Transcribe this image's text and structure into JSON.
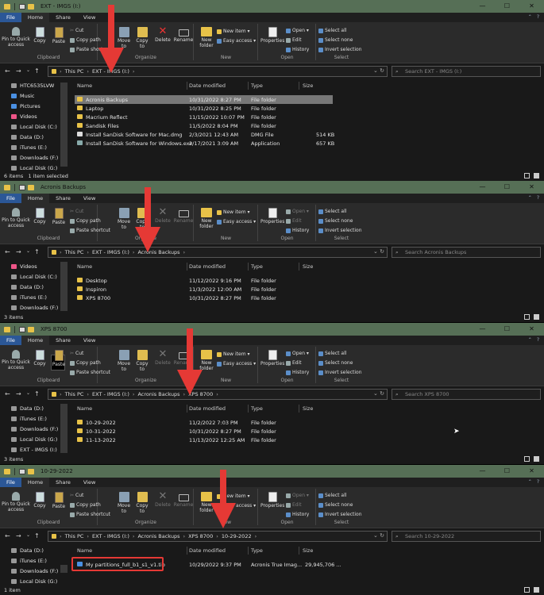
{
  "caption": {
    "min": "—",
    "max": "☐",
    "close": "✕"
  },
  "ribbon": {
    "tabs": [
      "File",
      "Home",
      "Share",
      "View"
    ],
    "pin": "Pin to Quick access",
    "copy": "Copy",
    "paste": "Paste",
    "cut": "Cut",
    "copy_path": "Copy path",
    "paste_shortcut": "Paste shortcut",
    "clipboard": "Clipboard",
    "move_to": "Move to",
    "copy_to": "Copy to",
    "delete": "Delete",
    "rename": "Rename",
    "organize": "Organize",
    "new_folder": "New folder",
    "new_item": "New item ▾",
    "easy_access": "Easy access ▾",
    "new": "New",
    "properties": "Properties",
    "open": "Open ▾",
    "edit": "Edit",
    "history": "History",
    "open_group": "Open",
    "select_all": "Select all",
    "select_none": "Select none",
    "invert_selection": "Invert selection",
    "select": "Select"
  },
  "columns": {
    "name": "Name",
    "date": "Date modified",
    "type": "Type",
    "size": "Size"
  },
  "windows": [
    {
      "title": "EXT - IMGS (I:)",
      "crumbs": [
        "This PC",
        "EXT - IMGS (I:)"
      ],
      "search": "Search EXT - IMGS (I:)",
      "nav": [
        "HTC6535LVW",
        "Music",
        "Pictures",
        "Videos",
        "Local Disk (C:)",
        "Data (D:)",
        "iTunes (E:)",
        "Downloads (F:)",
        "Local Disk (G:)"
      ],
      "files": [
        {
          "name": "Acronis Backups",
          "date": "10/31/2022 8:27 PM",
          "type": "File folder",
          "size": ""
        },
        {
          "name": "Laptop",
          "date": "10/31/2022 8:25 PM",
          "type": "File folder",
          "size": ""
        },
        {
          "name": "Macrium Reflect",
          "date": "11/15/2022 10:07 PM",
          "type": "File folder",
          "size": ""
        },
        {
          "name": "Sandisk Files",
          "date": "11/5/2022 8:04 PM",
          "type": "File folder",
          "size": ""
        },
        {
          "name": "Install SanDisk Software for Mac.dmg",
          "date": "2/3/2021 12:43 AM",
          "type": "DMG File",
          "size": "514 KB"
        },
        {
          "name": "Install SanDisk Software for Windows.exe",
          "date": "2/17/2021 3:09 AM",
          "type": "Application",
          "size": "657 KB"
        }
      ],
      "status": "6 items",
      "status_sel": "1 item selected"
    },
    {
      "title": "Acronis Backups",
      "crumbs": [
        "This PC",
        "EXT - IMGS (I:)",
        "Acronis Backups"
      ],
      "search": "Search Acronis Backups",
      "nav": [
        "Videos",
        "Local Disk (C:)",
        "Data (D:)",
        "iTunes (E:)",
        "Downloads (F:)"
      ],
      "files": [
        {
          "name": "Desktop",
          "date": "11/12/2022 9:16 PM",
          "type": "File folder",
          "size": ""
        },
        {
          "name": "Inspiron",
          "date": "11/3/2022 12:00 AM",
          "type": "File folder",
          "size": ""
        },
        {
          "name": "XPS 8700",
          "date": "10/31/2022 8:27 PM",
          "type": "File folder",
          "size": ""
        }
      ],
      "status": "3 items"
    },
    {
      "title": "XPS 8700",
      "crumbs": [
        "This PC",
        "EXT - IMGS (I:)",
        "Acronis Backups",
        "XPS 8700"
      ],
      "search": "Search XPS 8700",
      "nav": [
        "Data (D:)",
        "iTunes (E:)",
        "Downloads (F:)",
        "Local Disk (G:)",
        "EXT - IMGS (I:)"
      ],
      "files": [
        {
          "name": "10-29-2022",
          "date": "11/2/2022 7:03 PM",
          "type": "File folder",
          "size": ""
        },
        {
          "name": "10-31-2022",
          "date": "10/31/2022 8:27 PM",
          "type": "File folder",
          "size": ""
        },
        {
          "name": "11-13-2022",
          "date": "11/13/2022 12:25 AM",
          "type": "File folder",
          "size": ""
        }
      ],
      "status": "3 items"
    },
    {
      "title": "10-29-2022",
      "crumbs": [
        "This PC",
        "EXT - IMGS (I:)",
        "Acronis Backups",
        "XPS 8700",
        "10-29-2022"
      ],
      "search": "Search 10-29-2022",
      "nav": [
        "Data (D:)",
        "iTunes (E:)",
        "Downloads (F:)",
        "Local Disk (G:)"
      ],
      "files": [
        {
          "name": "My partitions_full_b1_s1_v1.tib",
          "date": "10/29/2022 9:37 PM",
          "type": "Acronis True Imag...",
          "size": "29,945,706 ..."
        }
      ],
      "status": "1 item"
    }
  ]
}
